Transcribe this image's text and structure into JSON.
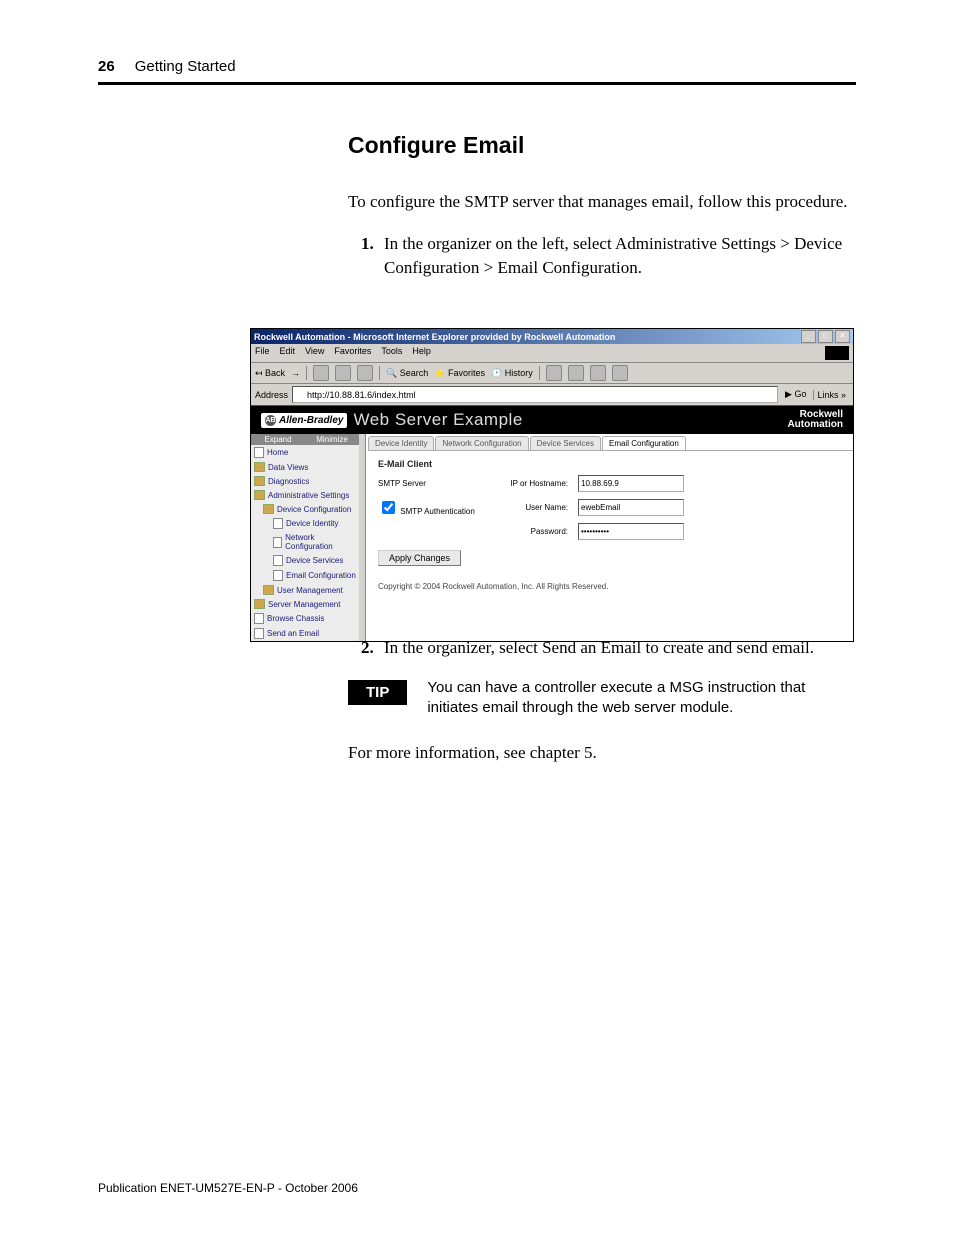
{
  "page": {
    "number": "26",
    "section": "Getting Started",
    "publication": "Publication ENET-UM527E-EN-P - October 2006"
  },
  "article": {
    "title": "Configure Email",
    "intro": "To configure the SMTP server that manages email, follow this procedure.",
    "step1": "In the organizer on the left, select Administrative Settings > Device Configuration > Email Configuration.",
    "step2": "In the organizer, select Send an Email to create and send email.",
    "tip_label": "TIP",
    "tip_text": "You can have a controller execute a MSG instruction that initiates email through the web server module.",
    "closing": "For more information, see chapter 5."
  },
  "ie": {
    "title": "Rockwell Automation - Microsoft Internet Explorer provided by Rockwell Automation",
    "menus": [
      "File",
      "Edit",
      "View",
      "Favorites",
      "Tools",
      "Help"
    ],
    "back": "Back",
    "search": "Search",
    "favorites": "Favorites",
    "history": "History",
    "addr_label": "Address",
    "url": "http://10.88.81.6/index.html",
    "go": "Go",
    "links": "Links"
  },
  "site": {
    "brand_ab": "Allen-Bradley",
    "heading": "Web Server Example",
    "brand_ra1": "Rockwell",
    "brand_ra2": "Automation",
    "expand": "Expand",
    "minimize": "Minimize",
    "nav": {
      "home": "Home",
      "data_views": "Data Views",
      "diagnostics": "Diagnostics",
      "admin": "Administrative Settings",
      "devcfg": "Device Configuration",
      "dev_identity": "Device Identity",
      "net_cfg": "Network Configuration",
      "dev_services": "Device Services",
      "email_cfg": "Email Configuration",
      "user_mgmt": "User Management",
      "server_mgmt": "Server Management",
      "browse_chassis": "Browse Chassis",
      "send_email": "Send an Email"
    },
    "tabs": {
      "dev_identity": "Device Identity",
      "net_cfg": "Network Configuration",
      "dev_services": "Device Services",
      "email_cfg": "Email Configuration"
    },
    "panel": {
      "header": "E-Mail Client",
      "smtp_server": "SMTP Server",
      "ip_host": "IP or Hostname:",
      "ip_value": "10.88.69.9",
      "smtp_auth": "SMTP Authentication",
      "user_label": "User Name:",
      "user_value": "ewebEmail",
      "pass_label": "Password:",
      "pass_value": "**********",
      "apply": "Apply Changes",
      "copyright": "Copyright © 2004 Rockwell Automation, Inc. All Rights Reserved."
    }
  }
}
